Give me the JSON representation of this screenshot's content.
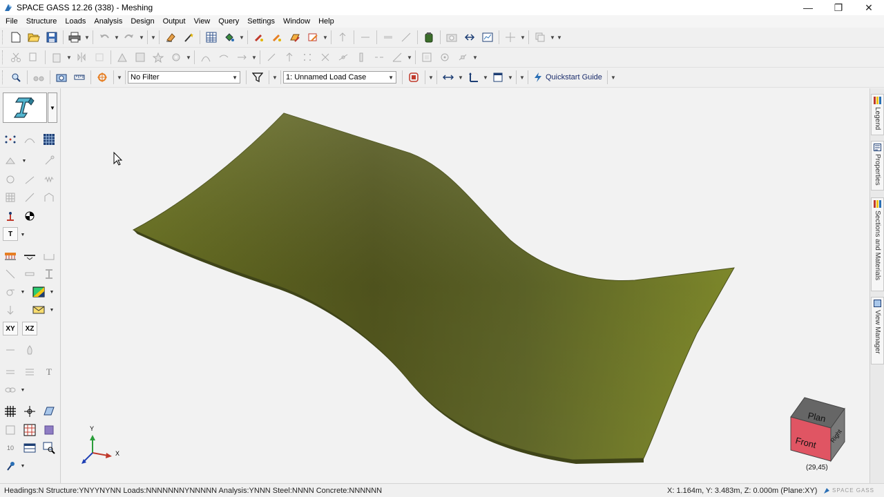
{
  "window": {
    "title": "SPACE GASS 12.26 (338) - Meshing",
    "minimize": "—",
    "restore": "❐",
    "close": "✕"
  },
  "menu": {
    "items": [
      "File",
      "Structure",
      "Loads",
      "Analysis",
      "Design",
      "Output",
      "View",
      "Query",
      "Settings",
      "Window",
      "Help"
    ]
  },
  "toolbar3": {
    "filter_value": "No Filter",
    "load_case_value": "1: Unnamed Load Case",
    "quickstart_label": "Quickstart Guide"
  },
  "left_panel": {
    "text_tool": "T",
    "xy_label": "XY",
    "xz_label": "XZ",
    "text_style": "T",
    "value_label": "10"
  },
  "viewport": {
    "axis_y": "Y",
    "axis_x": "X",
    "view_cube_top": "Plan",
    "view_cube_front": "Front",
    "view_cube_right": "Right",
    "view_angle": "(29,45)",
    "surface_color": "#7d8a2a"
  },
  "right_tabs": [
    "Legend",
    "Properties",
    "Sections and Materials",
    "View Manager"
  ],
  "status": {
    "left": "Headings:N Structure:YNYYNYNN Loads:NNNNNNNYNNNNN Analysis:YNNN Steel:NNNN Concrete:NNNNNN",
    "coords": "X: 1.164m, Y: 3.483m, Z: 0.000m (Plane:XY)",
    "logo": "SPACE GASS"
  }
}
